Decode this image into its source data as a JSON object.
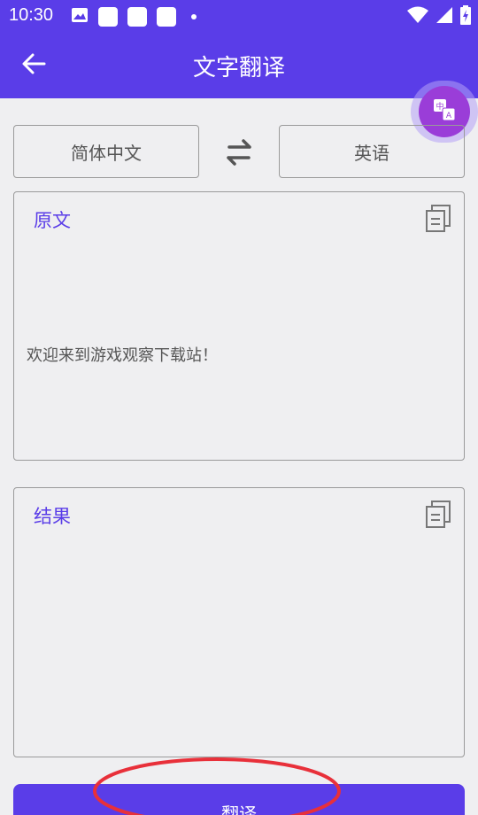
{
  "status_bar": {
    "time": "10:30"
  },
  "toolbar": {
    "title": "文字翻译"
  },
  "languages": {
    "source": "简体中文",
    "target": "英语"
  },
  "source_panel": {
    "label": "原文",
    "text": "欢迎来到游戏观察下载站！"
  },
  "result_panel": {
    "label": "结果",
    "text": ""
  },
  "actions": {
    "translate_label": "翻译"
  },
  "colors": {
    "primary": "#5a3de8",
    "fab": "#9a3dd8",
    "background": "#efeff1",
    "highlight": "#e8303a"
  }
}
